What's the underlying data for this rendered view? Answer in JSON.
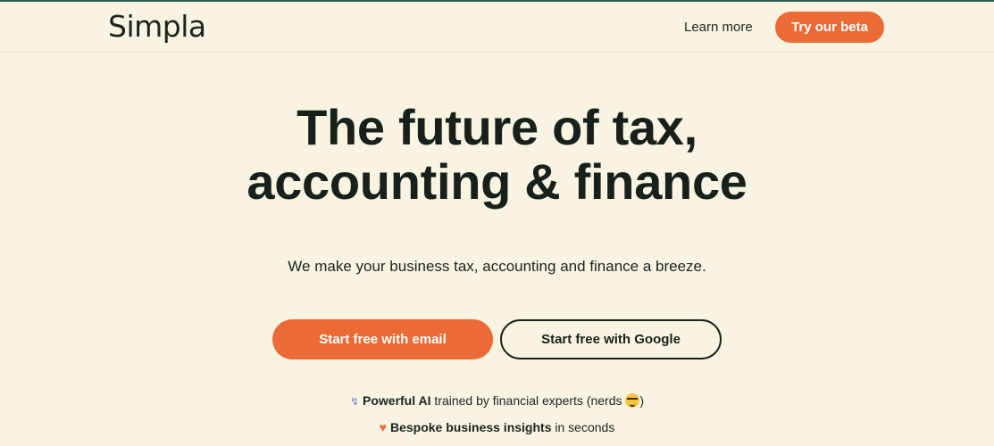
{
  "header": {
    "logo": "Simpla",
    "learn_more": "Learn more",
    "beta_button": "Try our beta"
  },
  "hero": {
    "title_line1": "The future of tax,",
    "title_line2": "accounting & finance",
    "subtitle": "We make your business tax, accounting and finance a breeze.",
    "email_button": "Start free with email",
    "google_button": "Start free with Google"
  },
  "features": [
    {
      "icon": "bolt-icon",
      "strong": "Powerful AI",
      "rest": " trained by financial experts (nerds ",
      "end_icon": "nerd-face-icon",
      "close": ")"
    },
    {
      "icon": "heart-icon",
      "strong": "Bespoke business insights",
      "rest": " in seconds"
    }
  ],
  "colors": {
    "background": "#f9f4e2",
    "accent": "#ec6a36",
    "text": "#17201a"
  }
}
